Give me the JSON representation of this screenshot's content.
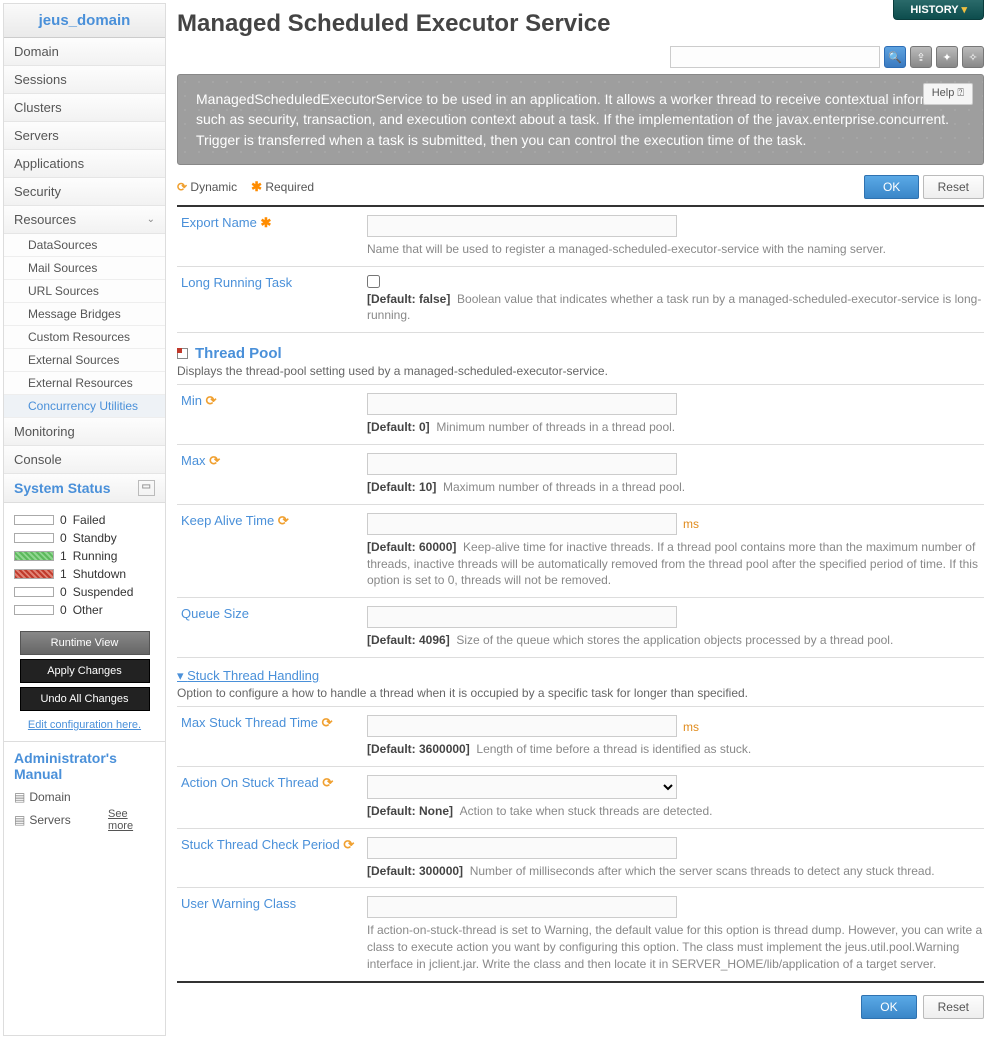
{
  "sidebar": {
    "header": "jeus_domain",
    "items": [
      "Domain",
      "Sessions",
      "Clusters",
      "Servers",
      "Applications",
      "Security"
    ],
    "resourcesLabel": "Resources",
    "subs": [
      "DataSources",
      "Mail Sources",
      "URL Sources",
      "Message Bridges",
      "Custom Resources",
      "External Sources",
      "External Resources",
      "Concurrency Utilities"
    ],
    "monitoring": "Monitoring",
    "console": "Console"
  },
  "status": {
    "title": "System Status",
    "rows": [
      {
        "n": "0",
        "label": "Failed"
      },
      {
        "n": "0",
        "label": "Standby"
      },
      {
        "n": "1",
        "label": "Running"
      },
      {
        "n": "1",
        "label": "Shutdown"
      },
      {
        "n": "0",
        "label": "Suspended"
      },
      {
        "n": "0",
        "label": "Other"
      }
    ]
  },
  "buttons": {
    "runtime": "Runtime View",
    "apply": "Apply Changes",
    "undo": "Undo All Changes",
    "editLink": "Edit configuration here."
  },
  "manual": {
    "title": "Administrator's Manual",
    "l1": "Domain",
    "l2": "Servers",
    "see": "See more"
  },
  "history": "HISTORY",
  "page": {
    "title": "Managed Scheduled Executor Service"
  },
  "desc": "ManagedScheduledExecutorService to be used in an application. It allows a worker thread to receive contextual information such as security, transaction, and execution context about a task. If the implementation of the javax.enterprise.concurrent. Trigger is transferred when a task is submitted, then you can control the execution time of the task.",
  "help": "Help ⍰",
  "legend": {
    "dyn": "Dynamic",
    "req": "Required"
  },
  "ok": "OK",
  "reset": "Reset",
  "f": {
    "exportName": {
      "label": "Export Name",
      "hint": "Name that will be used to register a managed-scheduled-executor-service with the naming server."
    },
    "longRun": {
      "label": "Long Running Task",
      "def": "[Default: false]",
      "hint": "Boolean value that indicates whether a task run by a managed-scheduled-executor-service is long-running."
    },
    "threadPool": {
      "title": "Thread Pool",
      "desc": "Displays the thread-pool setting used by a managed-scheduled-executor-service."
    },
    "min": {
      "label": "Min",
      "def": "[Default: 0]",
      "hint": "Minimum number of threads in a thread pool."
    },
    "max": {
      "label": "Max",
      "def": "[Default: 10]",
      "hint": "Maximum number of threads in a thread pool."
    },
    "keep": {
      "label": "Keep Alive Time",
      "def": "[Default: 60000]",
      "hint": "Keep-alive time for inactive threads. If a thread pool contains more than the maximum number of threads, inactive threads will be automatically removed from the thread pool after the specified period of time. If this option is set to 0, threads will not be removed.",
      "unit": "ms"
    },
    "queue": {
      "label": "Queue Size",
      "def": "[Default: 4096]",
      "hint": "Size of the queue which stores the application objects processed by a thread pool."
    },
    "stuckSection": {
      "title": "Stuck Thread Handling",
      "desc": "Option to configure a how to handle a thread when it is occupied by a specific task for longer than specified."
    },
    "maxStuck": {
      "label": "Max Stuck Thread Time",
      "def": "[Default: 3600000]",
      "hint": "Length of time before a thread is identified as stuck.",
      "unit": "ms"
    },
    "action": {
      "label": "Action On Stuck Thread",
      "def": "[Default: None]",
      "hint": "Action to take when stuck threads are detected."
    },
    "check": {
      "label": "Stuck Thread Check Period",
      "def": "[Default: 300000]",
      "hint": "Number of milliseconds after which the server scans threads to detect any stuck thread."
    },
    "warn": {
      "label": "User Warning Class",
      "hint": "If action-on-stuck-thread is set to Warning, the default value for this option is thread dump. However, you can write a class to execute action you want by configuring this option. The class must implement the jeus.util.pool.Warning interface in jclient.jar. Write the class and then locate it in SERVER_HOME/lib/application of a target server."
    }
  }
}
